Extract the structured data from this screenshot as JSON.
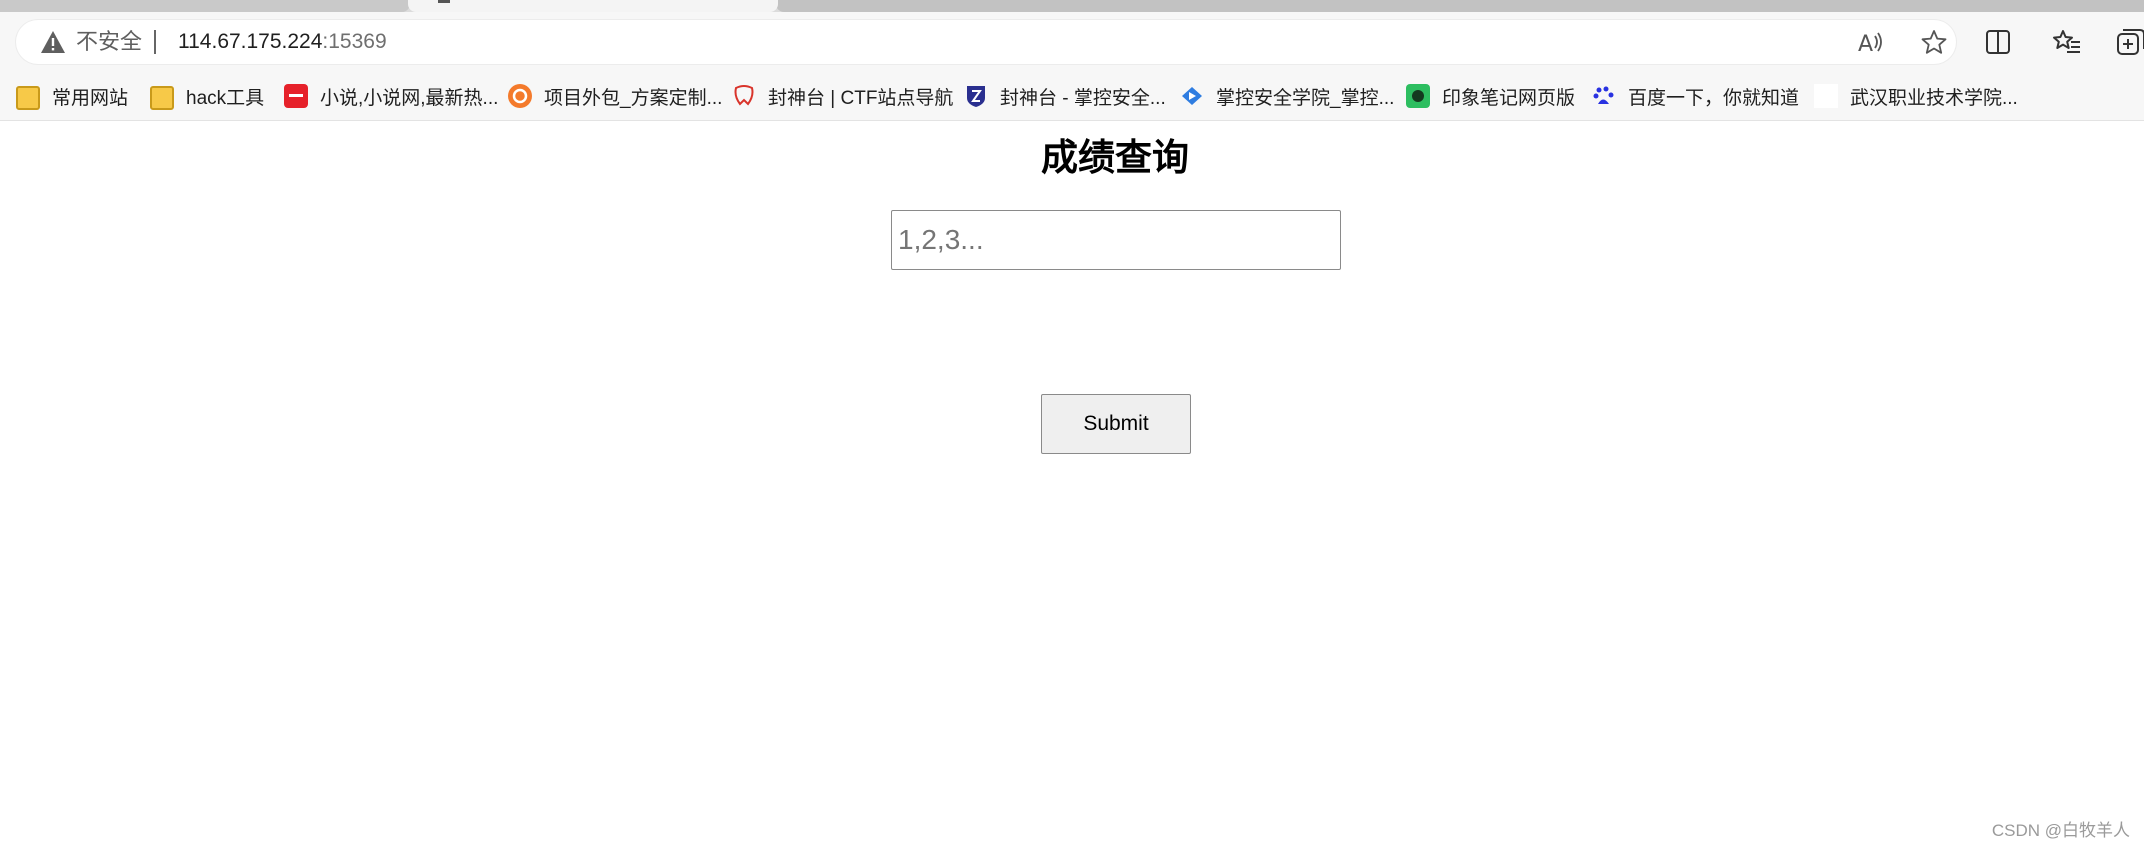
{
  "browser": {
    "address_bar": {
      "security_label": "不安全",
      "url_host": "114.67.175.224",
      "url_port": ":15369"
    },
    "icons": {
      "warning": "warning-triangle-icon",
      "read_aloud": "read-aloud-icon",
      "favorite": "star-icon",
      "split_screen": "split-screen-icon",
      "favorites": "favorites-list-icon",
      "collections": "collections-icon"
    },
    "bookmarks": [
      {
        "label": "常用网站",
        "icon": "folder-icon"
      },
      {
        "label": "hack工具",
        "icon": "folder-icon"
      },
      {
        "label": "小说,小说网,最新热...",
        "icon": "qidian-icon",
        "color": "#e6212a"
      },
      {
        "label": "项目外包_方案定制...",
        "icon": "outsource-icon",
        "color": "#f47a2b"
      },
      {
        "label": "封神台 | CTF站点导航",
        "icon": "fengshentai-icon",
        "color": "#d9342b"
      },
      {
        "label": "封神台 - 掌控安全...",
        "icon": "shield-logo-icon",
        "color": "#2a2f8f"
      },
      {
        "label": "掌控安全学院_掌控...",
        "icon": "zkaq-icon",
        "color": "#2f7de1"
      },
      {
        "label": "印象笔记网页版",
        "icon": "evernote-icon",
        "color": "#2dbe60"
      },
      {
        "label": "百度一下，你就知道",
        "icon": "baidu-paw-icon",
        "color": "#2932e1"
      },
      {
        "label": "武汉职业技术学院...",
        "icon": "blank-page-icon"
      }
    ]
  },
  "page": {
    "title": "成绩查询",
    "input_placeholder": "1,2,3...",
    "submit_label": "Submit"
  },
  "watermark": "CSDN @白牧羊人"
}
